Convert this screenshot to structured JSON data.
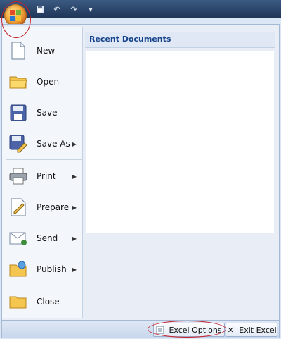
{
  "window": {
    "title": "",
    "qat": {
      "save_icon": "save-icon",
      "undo_icon": "undo-icon",
      "redo_icon": "redo-icon",
      "customize_icon": "customize-qat-icon"
    }
  },
  "menu": {
    "items": [
      {
        "label": "New",
        "icon": "new-document-icon",
        "has_submenu": false
      },
      {
        "label": "Open",
        "icon": "open-folder-icon",
        "has_submenu": false
      },
      {
        "label": "Save",
        "icon": "save-disk-icon",
        "has_submenu": false
      },
      {
        "label": "Save As",
        "icon": "save-as-icon",
        "has_submenu": true
      },
      {
        "label": "Print",
        "icon": "printer-icon",
        "has_submenu": true
      },
      {
        "label": "Prepare",
        "icon": "prepare-icon",
        "has_submenu": true
      },
      {
        "label": "Send",
        "icon": "send-icon",
        "has_submenu": true
      },
      {
        "label": "Publish",
        "icon": "publish-icon",
        "has_submenu": true
      },
      {
        "label": "Close",
        "icon": "close-folder-icon",
        "has_submenu": false
      }
    ]
  },
  "recent": {
    "title": "Recent Documents",
    "items": []
  },
  "footer": {
    "options_label": "Excel Options",
    "exit_label": "Exit Excel"
  },
  "colors": {
    "accent": "#15428b",
    "highlight": "#c8202a",
    "orb": "#f2a53a"
  }
}
